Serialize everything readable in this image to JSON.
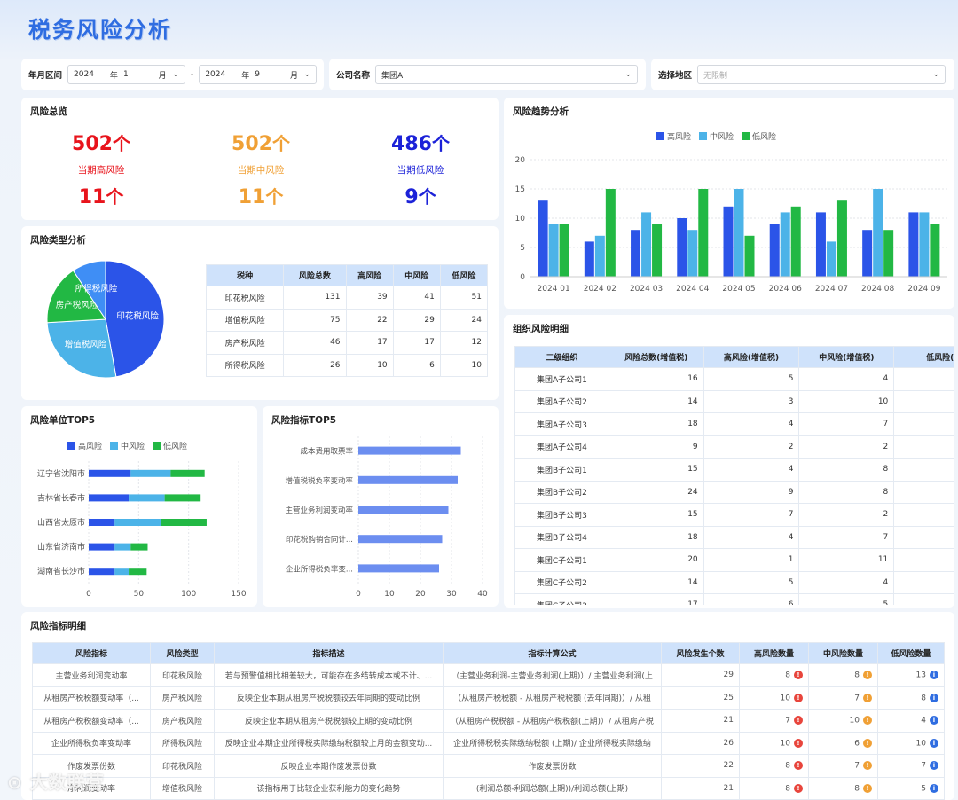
{
  "page_title": "税务风险分析",
  "filters": {
    "date_label": "年月区间",
    "start_year": "2024",
    "start_year_unit": "年",
    "start_month": "1",
    "start_month_unit": "月",
    "separator": "-",
    "end_year": "2024",
    "end_year_unit": "年",
    "end_month": "9",
    "end_month_unit": "月",
    "company_label": "公司名称",
    "company_value": "集团A",
    "region_label": "选择地区",
    "region_placeholder": "无限制"
  },
  "overview": {
    "title": "风险总览",
    "high": {
      "total": "502",
      "unit": "个",
      "label": "当期高风险",
      "current": "11"
    },
    "mid": {
      "total": "502",
      "unit": "个",
      "label": "当期中风险",
      "current": "11"
    },
    "low": {
      "total": "486",
      "unit": "个",
      "label": "当期低风险",
      "current": "9"
    },
    "colors": {
      "high": "#e8141c",
      "mid": "#f0a035",
      "low": "#1c22d8"
    }
  },
  "risk_type": {
    "title": "风险类型分析",
    "headers": [
      "税种",
      "风险总数",
      "高风险",
      "中风险",
      "低风险"
    ],
    "rows": [
      [
        "印花税风险",
        "131",
        "39",
        "41",
        "51"
      ],
      [
        "增值税风险",
        "75",
        "22",
        "29",
        "24"
      ],
      [
        "房产税风险",
        "46",
        "17",
        "17",
        "12"
      ],
      [
        "所得税风险",
        "26",
        "10",
        "6",
        "10"
      ]
    ]
  },
  "trend": {
    "title": "风险趋势分析"
  },
  "org": {
    "title": "组织风险明细",
    "headers": [
      "二级组织",
      "风险总数(增值税)",
      "高风险(增值税)",
      "中风险(增值税)",
      "低风险("
    ],
    "rows": [
      [
        "集团A子公司1",
        "16",
        "5",
        "4"
      ],
      [
        "集团A子公司2",
        "14",
        "3",
        "10"
      ],
      [
        "集团A子公司3",
        "18",
        "4",
        "7"
      ],
      [
        "集团A子公司4",
        "9",
        "2",
        "2"
      ],
      [
        "集团B子公司1",
        "15",
        "4",
        "8"
      ],
      [
        "集团B子公司2",
        "24",
        "9",
        "8"
      ],
      [
        "集团B子公司3",
        "15",
        "7",
        "2"
      ],
      [
        "集团B子公司4",
        "18",
        "4",
        "7"
      ],
      [
        "集团C子公司1",
        "20",
        "1",
        "11"
      ],
      [
        "集团C子公司2",
        "14",
        "5",
        "4"
      ],
      [
        "集团C子公司3",
        "17",
        "6",
        "5"
      ]
    ]
  },
  "unit_top5": {
    "title": "风险单位TOP5"
  },
  "indicator_top5": {
    "title": "风险指标TOP5"
  },
  "indicator_detail": {
    "title": "风险指标明细",
    "headers": [
      "风险指标",
      "风险类型",
      "指标描述",
      "指标计算公式",
      "风险发生个数",
      "高风险数量",
      "中风险数量",
      "低风险数量"
    ],
    "rows": [
      [
        "主营业务利润变动率",
        "印花税风险",
        "若与预警值相比相差较大，可能存在多结转成本或不计、...",
        "（主营业务利润-主营业务利润(上期)）/ 主营业务利润(上",
        "29",
        "8",
        "8",
        "13"
      ],
      [
        "从租房产税税额变动率（...",
        "房产税风险",
        "反映企业本期从租房产税税额较去年同期的变动比例",
        "（从租房产税税额 - 从租房产税税额 (去年同期)）/ 从租",
        "25",
        "10",
        "7",
        "8"
      ],
      [
        "从租房产税税额变动率（...",
        "房产税风险",
        "反映企业本期从租房产税税额较上期的变动比例",
        "（从租房产税税额 - 从租房产税税额(上期)）/ 从租房产税",
        "21",
        "7",
        "10",
        "4"
      ],
      [
        "企业所得税负率变动率",
        "所得税风险",
        "反映企业本期企业所得税实际缴纳税额较上月的金额变动...",
        "企业所得税税实际缴纳税额 (上期)/ 企业所得税实际缴纳",
        "26",
        "10",
        "6",
        "10"
      ],
      [
        "作废发票份数",
        "印花税风险",
        "反映企业本期作废发票份数",
        "作废发票份数",
        "22",
        "8",
        "7",
        "7"
      ],
      [
        "净利润变动率",
        "增值税风险",
        "该指标用于比较企业获利能力的变化趋势",
        "(利润总额-利润总额(上期))/利润总额(上期)",
        "21",
        "8",
        "8",
        "5"
      ]
    ],
    "icon_colors": {
      "high": "#e8453c",
      "mid": "#f0a035",
      "low": "#2f6de1"
    }
  },
  "watermark": "大数联营",
  "legend": {
    "high": "高风险",
    "mid": "中风险",
    "low": "低风险"
  },
  "series_colors": {
    "high": "#2b54e8",
    "mid": "#4cb3e8",
    "low": "#22b844"
  },
  "chart_data": [
    {
      "id": "pie",
      "type": "pie",
      "categories": [
        "印花税风险",
        "增值税风险",
        "房产税风险",
        "所得税风险"
      ],
      "values": [
        131,
        75,
        46,
        26
      ],
      "colors": [
        "#2b54e8",
        "#4cb3e8",
        "#22b844",
        "#3f8ef5"
      ]
    },
    {
      "id": "trend",
      "type": "bar",
      "categories": [
        "2024 01",
        "2024 02",
        "2024 03",
        "2024 04",
        "2024 05",
        "2024 06",
        "2024 07",
        "2024 08",
        "2024 09"
      ],
      "series": [
        {
          "name": "高风险",
          "values": [
            13,
            6,
            8,
            10,
            12,
            9,
            11,
            8,
            11
          ]
        },
        {
          "name": "中风险",
          "values": [
            9,
            7,
            11,
            8,
            15,
            11,
            6,
            15,
            11
          ]
        },
        {
          "name": "低风险",
          "values": [
            9,
            15,
            9,
            15,
            7,
            12,
            13,
            8,
            9
          ]
        }
      ],
      "ylim": [
        0,
        20
      ],
      "yticks": [
        0,
        5,
        10,
        15,
        20
      ],
      "legend": "top"
    },
    {
      "id": "units",
      "type": "bar",
      "orientation": "horizontal",
      "stacked": true,
      "categories": [
        "辽宁省沈阳市",
        "吉林省长春市",
        "山西省太原市",
        "山东省济南市",
        "湖南省长沙市"
      ],
      "series": [
        {
          "name": "高风险",
          "values": [
            42,
            40,
            26,
            26,
            26
          ]
        },
        {
          "name": "中风险",
          "values": [
            40,
            36,
            46,
            16,
            14
          ]
        },
        {
          "name": "低风险",
          "values": [
            34,
            36,
            46,
            17,
            18
          ]
        }
      ],
      "xlim": [
        0,
        150
      ],
      "xticks": [
        0,
        50,
        100,
        150
      ],
      "legend": "top"
    },
    {
      "id": "indicators",
      "type": "bar",
      "orientation": "horizontal",
      "categories": [
        "成本费用取票率",
        "增值税税负率变动率",
        "主营业务利润变动率",
        "印花税购销合同计...",
        "企业所得税负率变..."
      ],
      "values": [
        33,
        32,
        29,
        27,
        26
      ],
      "xlim": [
        0,
        40
      ],
      "xticks": [
        0,
        10,
        20,
        30,
        40
      ],
      "color": "#6c8ef0"
    }
  ]
}
